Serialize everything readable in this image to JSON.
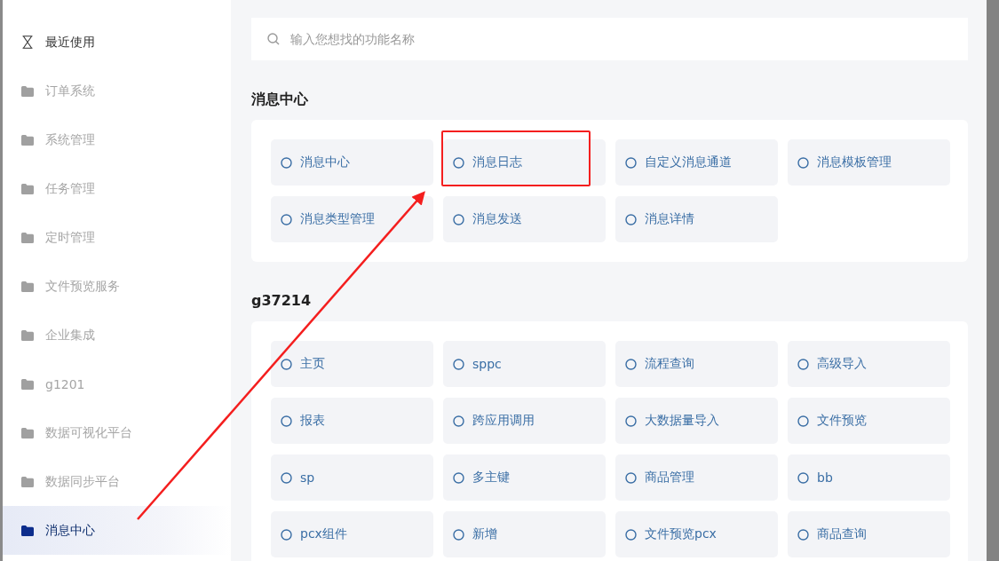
{
  "sidebar": {
    "items": [
      {
        "label": "最近使用",
        "kind": "recent",
        "selected": false
      },
      {
        "label": "订单系统",
        "kind": "folder",
        "selected": false
      },
      {
        "label": "系统管理",
        "kind": "folder",
        "selected": false
      },
      {
        "label": "任务管理",
        "kind": "folder",
        "selected": false
      },
      {
        "label": "定时管理",
        "kind": "folder",
        "selected": false
      },
      {
        "label": "文件预览服务",
        "kind": "folder",
        "selected": false
      },
      {
        "label": "企业集成",
        "kind": "folder",
        "selected": false
      },
      {
        "label": "g1201",
        "kind": "folder",
        "selected": false
      },
      {
        "label": "数据可视化平台",
        "kind": "folder",
        "selected": false
      },
      {
        "label": "数据同步平台",
        "kind": "folder",
        "selected": false
      },
      {
        "label": "消息中心",
        "kind": "folder",
        "selected": true
      }
    ]
  },
  "search": {
    "placeholder": "输入您想找的功能名称"
  },
  "sections": [
    {
      "title": "消息中心",
      "items": [
        {
          "label": "消息中心",
          "highlighted": false
        },
        {
          "label": "消息日志",
          "highlighted": true
        },
        {
          "label": "自定义消息通道",
          "highlighted": false
        },
        {
          "label": "消息模板管理",
          "highlighted": false
        },
        {
          "label": "消息类型管理",
          "highlighted": false
        },
        {
          "label": "消息发送",
          "highlighted": false
        },
        {
          "label": "消息详情",
          "highlighted": false
        }
      ]
    },
    {
      "title": "g37214",
      "items": [
        {
          "label": "主页",
          "highlighted": false
        },
        {
          "label": "sppc",
          "highlighted": false
        },
        {
          "label": "流程查询",
          "highlighted": false
        },
        {
          "label": "高级导入",
          "highlighted": false
        },
        {
          "label": "报表",
          "highlighted": false
        },
        {
          "label": "跨应用调用",
          "highlighted": false
        },
        {
          "label": "大数据量导入",
          "highlighted": false
        },
        {
          "label": "文件预览",
          "highlighted": false
        },
        {
          "label": "sp",
          "highlighted": false
        },
        {
          "label": "多主键",
          "highlighted": false
        },
        {
          "label": "商品管理",
          "highlighted": false
        },
        {
          "label": "bb",
          "highlighted": false
        },
        {
          "label": "pcx组件",
          "highlighted": false
        },
        {
          "label": "新增",
          "highlighted": false
        },
        {
          "label": "文件预览pcx",
          "highlighted": false
        },
        {
          "label": "商品查询",
          "highlighted": false
        }
      ]
    }
  ]
}
